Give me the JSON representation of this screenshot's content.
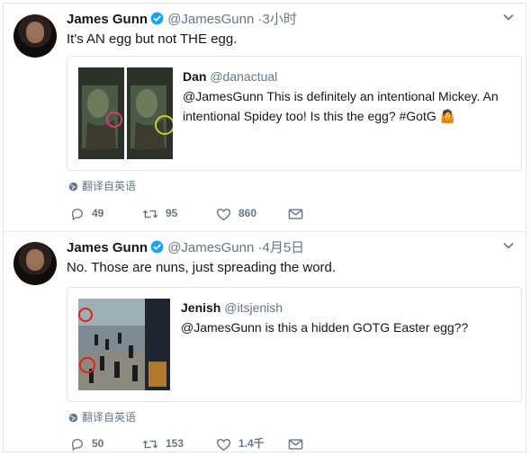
{
  "tweets": [
    {
      "name": "James Gunn",
      "handle": "@JamesGunn",
      "dot": "·",
      "time": "3小时",
      "text": "It's AN egg but not THE egg.",
      "quote": {
        "name": "Dan",
        "handle": "@danactual",
        "text": "@JamesGunn This is definitely an intentional Mickey. An intentional Spidey too! Is this the egg? #GotG",
        "emoji": "🤷"
      },
      "translate": "翻译自英语",
      "replies": "49",
      "retweets": "95",
      "likes": "860"
    },
    {
      "name": "James Gunn",
      "handle": "@JamesGunn",
      "dot": "·",
      "time": "4月5日",
      "text": "No. Those are nuns, just spreading the word.",
      "quote": {
        "name": "Jenish",
        "handle": "@itsjenish",
        "text": "@JamesGunn is this a hidden GOTG Easter egg??"
      },
      "translate": "翻译自英语",
      "replies": "50",
      "retweets": "153",
      "likes": "1.4千"
    }
  ],
  "colors": {
    "accent": "#1da1f2",
    "muted": "#657786",
    "border": "#e1e8ed"
  }
}
